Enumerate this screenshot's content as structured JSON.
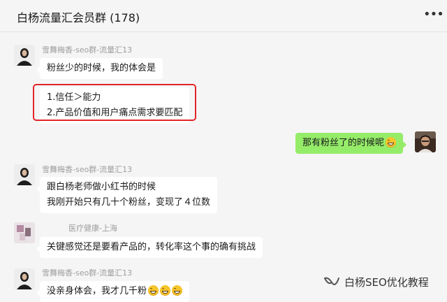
{
  "header": {
    "title": "白杨流量汇会员群 (178)",
    "more_icon": "more-dots-icon",
    "more_label": "•••"
  },
  "messages": [
    {
      "sender": "雪舞梅香-seo群-流量汇13",
      "bubbles": [
        {
          "lines": [
            "粉丝少的时候，我的体会是"
          ]
        },
        {
          "lines": [
            "1.信任＞能力",
            "2.产品价值和用户痛点需求要匹配"
          ],
          "highlighted": true
        }
      ]
    },
    {
      "sender": "",
      "self": true,
      "bubbles": [
        {
          "lines": [
            "那有粉丝了的时候呢"
          ],
          "emoji_count": 1
        }
      ]
    },
    {
      "sender": "雪舞梅香-seo群-流量汇13",
      "bubbles": [
        {
          "lines": [
            "跟白杨老师做小红书的时候",
            "我刚开始只有几十个粉丝，变现了４位数"
          ]
        }
      ]
    },
    {
      "sender": "医疗健康-上海",
      "bubbles": [
        {
          "lines": [
            "关键感觉还是要看产品的，转化率这个事的确有挑战"
          ]
        }
      ]
    },
    {
      "sender": "雪舞梅香-seo群-流量汇13",
      "bubbles": [
        {
          "lines": [
            "没亲身体会，我才几千粉"
          ],
          "emoji_count": 3
        }
      ]
    }
  ],
  "watermark": {
    "text": "白杨SEO优化教程",
    "icon": "wechat-channel-icon"
  },
  "colors": {
    "self_bubble": "#95ec69",
    "highlight_border": "#e0262a",
    "background": "#f5f5f5"
  }
}
